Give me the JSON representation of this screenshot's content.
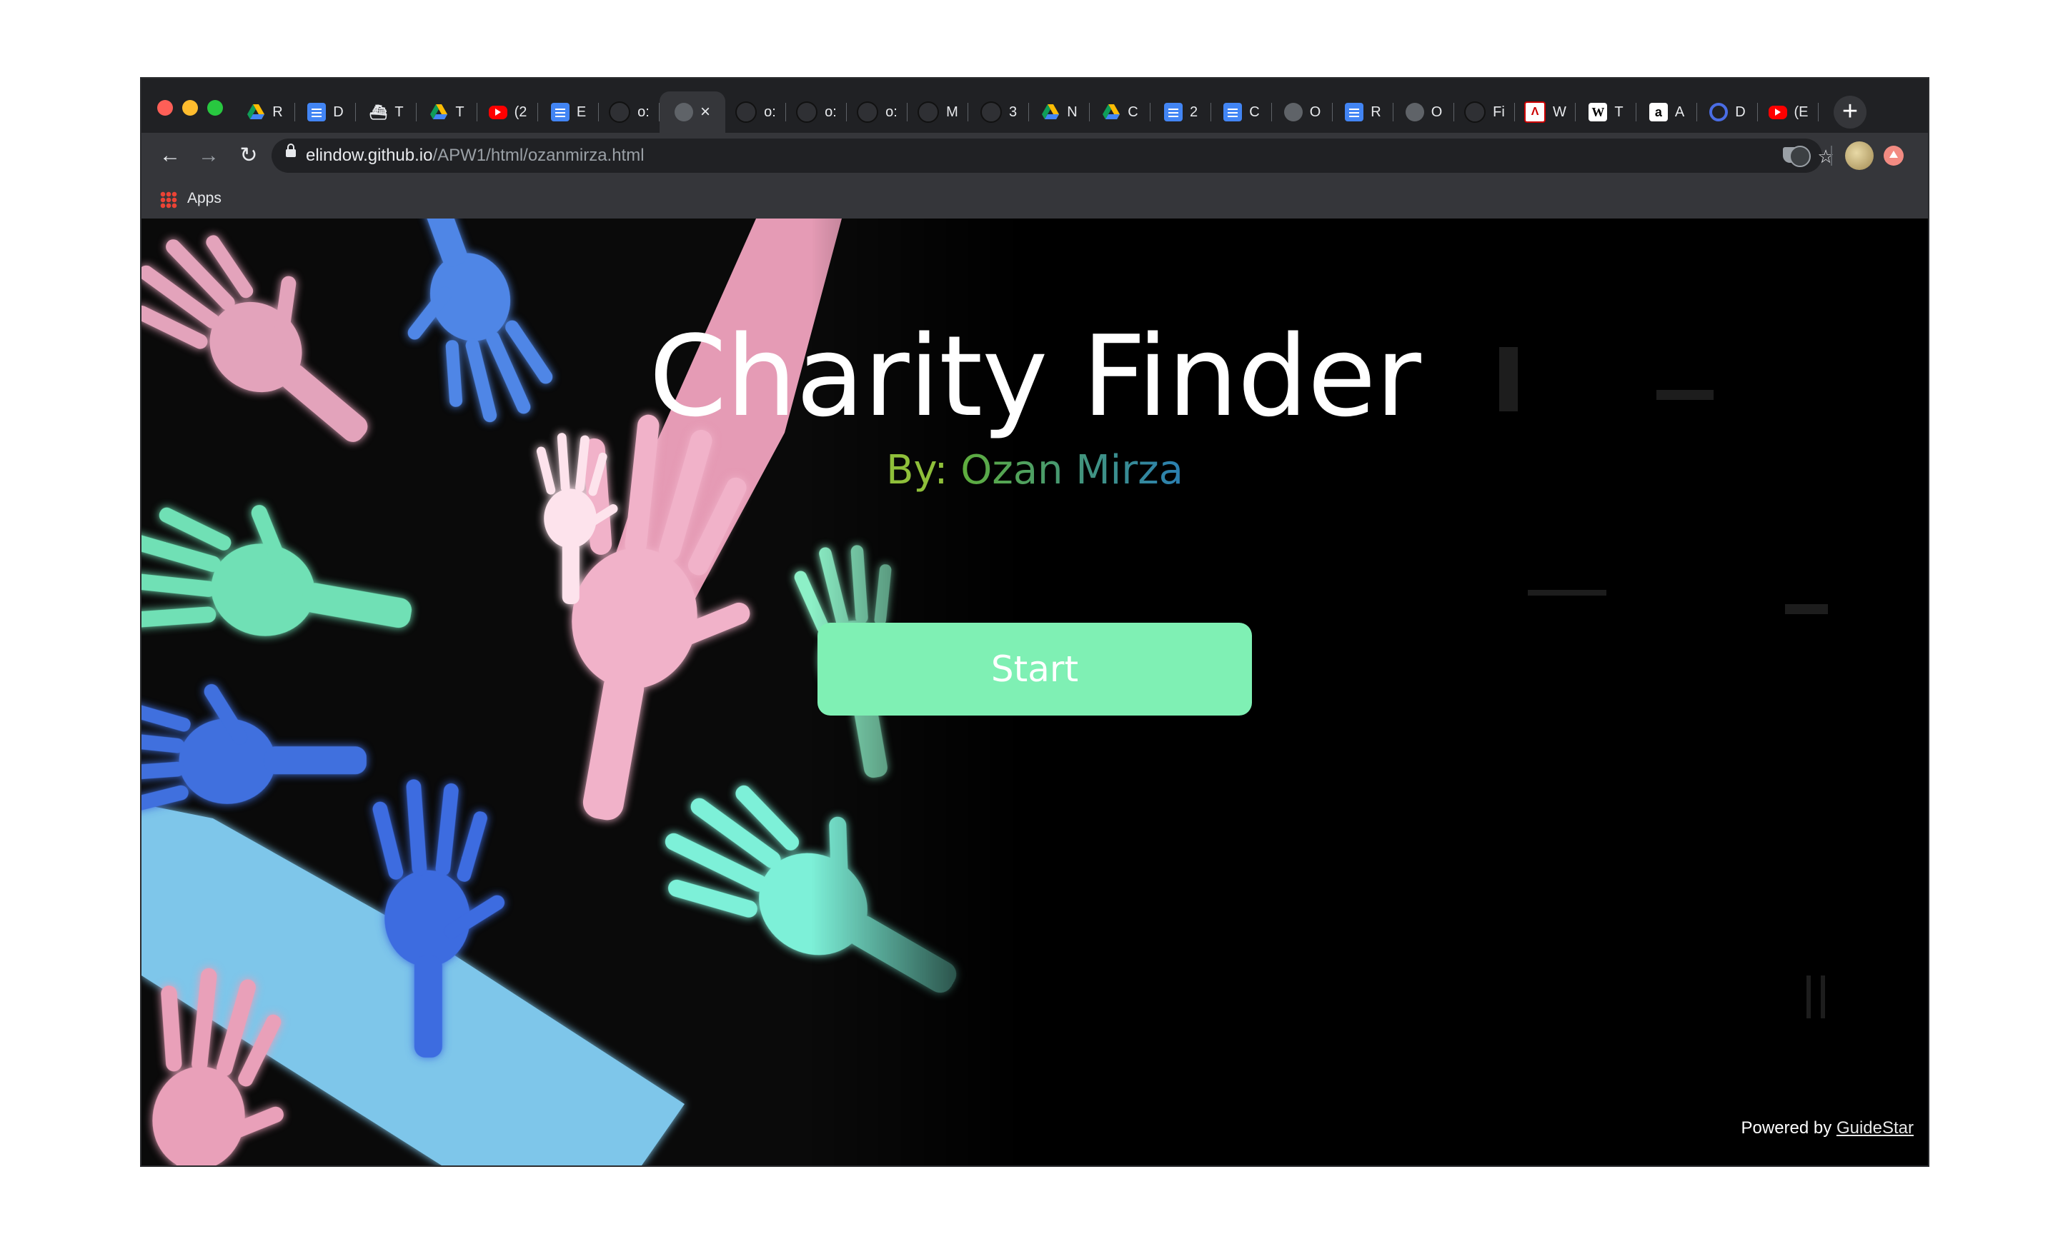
{
  "browser": {
    "tabs": [
      {
        "icon": "google-drive-icon",
        "label": "R"
      },
      {
        "icon": "google-docs-icon",
        "label": "D"
      },
      {
        "icon": "ship-icon",
        "label": "T"
      },
      {
        "icon": "google-drive-icon",
        "label": "T"
      },
      {
        "icon": "youtube-icon",
        "label": "(2"
      },
      {
        "icon": "google-docs-icon",
        "label": "E"
      },
      {
        "icon": "github-icon",
        "label": "o:"
      },
      {
        "icon": "globe-icon",
        "label": "",
        "active": true
      },
      {
        "icon": "github-icon",
        "label": "o:"
      },
      {
        "icon": "github-icon",
        "label": "o:"
      },
      {
        "icon": "github-icon",
        "label": "o:"
      },
      {
        "icon": "github-icon",
        "label": "M"
      },
      {
        "icon": "github-icon",
        "label": "3"
      },
      {
        "icon": "google-drive-icon",
        "label": "N"
      },
      {
        "icon": "google-drive-icon",
        "label": "C"
      },
      {
        "icon": "google-docs-icon",
        "label": "2"
      },
      {
        "icon": "google-docs-icon",
        "label": "C"
      },
      {
        "icon": "globe-icon",
        "label": "O"
      },
      {
        "icon": "google-docs-icon",
        "label": "R"
      },
      {
        "icon": "globe-icon",
        "label": "O"
      },
      {
        "icon": "github-icon",
        "label": "Fi"
      },
      {
        "icon": "acrobat-icon",
        "label": "W"
      },
      {
        "icon": "wikipedia-icon",
        "label": "T"
      },
      {
        "icon": "amazon-icon",
        "label": "A"
      },
      {
        "icon": "quizlet-icon",
        "label": "D"
      },
      {
        "icon": "youtube-icon",
        "label": "(E"
      }
    ],
    "new_tab": "+",
    "url_host": "elindow.github.io",
    "url_path": "/APW1/html/ozanmirza.html",
    "bookmarks_apps": "Apps"
  },
  "page": {
    "title": "Charity Finder",
    "subtitle_by": "By:",
    "subtitle_name": "Ozan Mirza",
    "start_button": "Start",
    "powered_by": "Powered by",
    "powered_link": "GuideStar"
  },
  "colors": {
    "title": "#ffffff",
    "start_button_bg": "#7ff0b4",
    "subtitle_green": "#7ab83a",
    "subtitle_blue": "#2a7fb3"
  }
}
